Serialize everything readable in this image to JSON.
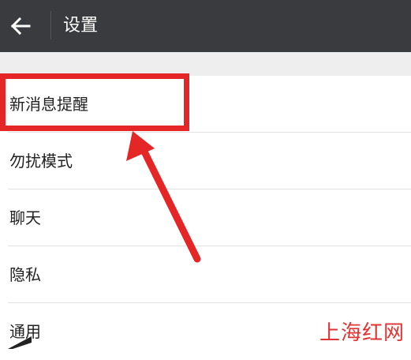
{
  "header": {
    "title": "设置",
    "back_icon": "arrow-left-icon"
  },
  "settings": {
    "items": [
      {
        "label": "新消息提醒"
      },
      {
        "label": "勿扰模式"
      },
      {
        "label": "聊天"
      },
      {
        "label": "隐私"
      },
      {
        "label": "通用"
      }
    ]
  },
  "annotation": {
    "color": "#e52626",
    "highlighted_item": "新消息提醒"
  },
  "watermark": {
    "text": "上海红网"
  },
  "colors": {
    "header_bg": "#3a3b3f",
    "list_bg": "#ffffff",
    "gap_bg": "#eeeeee"
  }
}
